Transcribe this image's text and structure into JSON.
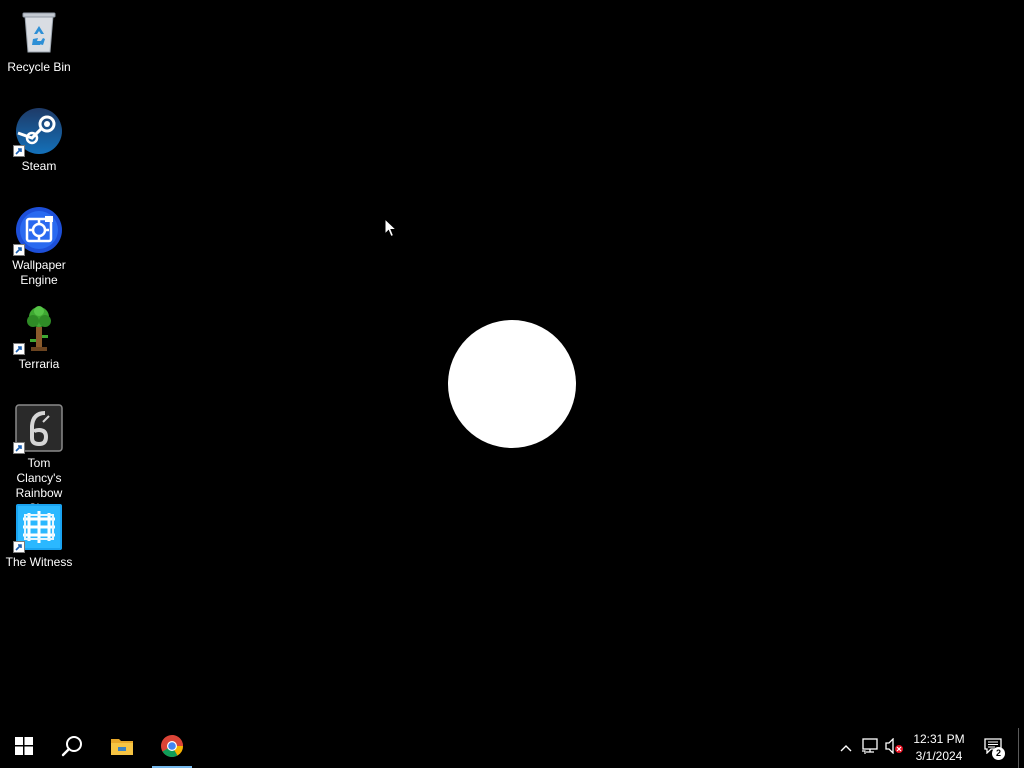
{
  "desktop": {
    "icons": [
      {
        "label": "Recycle Bin",
        "icon": "recycle-bin-icon",
        "shortcut": false
      },
      {
        "label": "Steam",
        "icon": "steam-icon",
        "shortcut": true
      },
      {
        "label": "Wallpaper Engine",
        "icon": "wallpaper-engine-icon",
        "shortcut": true
      },
      {
        "label": "Terraria",
        "icon": "terraria-icon",
        "shortcut": true
      },
      {
        "label": "Tom Clancy's Rainbow Si...",
        "icon": "rainbow-six-icon",
        "shortcut": true
      },
      {
        "label": "The Witness",
        "icon": "the-witness-icon",
        "shortcut": true
      }
    ],
    "background_color": "#000000",
    "loading_indicator": "white-circle"
  },
  "taskbar": {
    "pinned": [
      {
        "name": "Start",
        "icon": "windows-start-icon"
      },
      {
        "name": "Search",
        "icon": "search-icon"
      },
      {
        "name": "File Explorer",
        "icon": "file-explorer-icon"
      },
      {
        "name": "Google Chrome",
        "icon": "chrome-icon",
        "active": true
      }
    ],
    "tray": {
      "icons": [
        "chevron-up-icon",
        "network-icon",
        "volume-muted-icon"
      ],
      "time": "12:31 PM",
      "date": "3/1/2024",
      "notification_count": "2"
    },
    "accent_color": "#76b9ed"
  }
}
